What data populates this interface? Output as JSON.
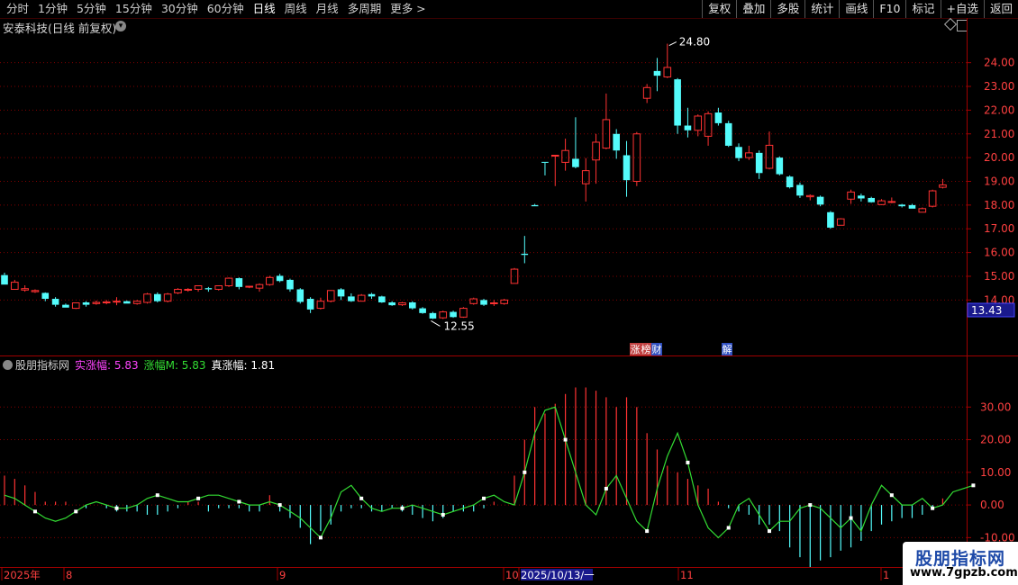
{
  "toolbar": {
    "periods": [
      "分时",
      "1分钟",
      "5分钟",
      "15分钟",
      "30分钟",
      "60分钟",
      "日线",
      "周线",
      "月线",
      "多周期",
      "更多 >"
    ],
    "active_period": "日线",
    "tools": [
      "复权",
      "叠加",
      "多股",
      "统计",
      "画线",
      "F10",
      "标记",
      "+自选",
      "返回"
    ]
  },
  "title": {
    "stock": "安泰科技(日线 前复权)"
  },
  "price_panel": {
    "max_label": "24.80",
    "min_label": "12.55",
    "current_price": "13.43",
    "ticks": [
      "24.00",
      "23.00",
      "22.00",
      "21.00",
      "20.00",
      "19.00",
      "18.00",
      "17.00",
      "16.00",
      "15.00",
      "14.00"
    ],
    "events": [
      "涨",
      "榜",
      "财",
      "解"
    ]
  },
  "indicator": {
    "name": "股朋指标网",
    "legend": [
      {
        "label": "实涨幅: 5.83",
        "color": "#ff44ff"
      },
      {
        "label": "涨幅M: 5.83",
        "color": "#33dd33"
      },
      {
        "label": "真涨幅: 1.81",
        "color": "#ffffff"
      }
    ],
    "ticks": [
      "30.00",
      "20.00",
      "10.00",
      "0.00",
      "-10.00"
    ]
  },
  "time_axis": {
    "labels": [
      "2025年",
      "8",
      "9",
      "10",
      "2025/10/13/一",
      "11",
      "1"
    ]
  },
  "watermark": {
    "line1": "股朋指标网",
    "line2": "www.7gpzb.com"
  },
  "colors": {
    "up": "#ff3232",
    "down": "#54fcfc",
    "grid": "#800000",
    "bg": "#000000"
  },
  "chart_data": {
    "type": "candlestick",
    "ylim": [
      11.7,
      25.2
    ],
    "indicator_ylim": [
      -19,
      40
    ],
    "candles": [
      [
        15.05,
        14.65,
        15.15,
        14.65
      ],
      [
        14.45,
        14.75,
        14.85,
        14.45
      ],
      [
        14.42,
        14.48,
        14.62,
        14.35
      ],
      [
        14.35,
        14.4,
        14.45,
        14.3
      ],
      [
        14.3,
        14.05,
        14.32,
        13.95
      ],
      [
        14.05,
        13.8,
        14.12,
        13.72
      ],
      [
        13.8,
        13.68,
        13.85,
        13.68
      ],
      [
        13.65,
        13.88,
        13.9,
        13.62
      ],
      [
        13.9,
        13.8,
        13.95,
        13.72
      ],
      [
        13.85,
        13.9,
        13.98,
        13.8
      ],
      [
        13.88,
        13.92,
        14.0,
        13.82
      ],
      [
        13.92,
        13.95,
        14.12,
        13.78
      ],
      [
        13.95,
        13.85,
        13.98,
        13.85
      ],
      [
        13.85,
        13.95,
        14.0,
        13.8
      ],
      [
        13.9,
        14.25,
        14.3,
        13.85
      ],
      [
        14.25,
        13.95,
        14.32,
        13.9
      ],
      [
        13.95,
        14.25,
        14.3,
        13.9
      ],
      [
        14.3,
        14.45,
        14.5,
        14.25
      ],
      [
        14.42,
        14.45,
        14.5,
        14.35
      ],
      [
        14.45,
        14.6,
        14.62,
        14.35
      ],
      [
        14.5,
        14.45,
        14.55,
        14.35
      ],
      [
        14.45,
        14.6,
        14.62,
        14.4
      ],
      [
        14.6,
        14.92,
        14.95,
        14.55
      ],
      [
        14.92,
        14.55,
        14.95,
        14.45
      ],
      [
        14.55,
        14.58,
        14.6,
        14.5
      ],
      [
        14.5,
        14.65,
        14.7,
        14.35
      ],
      [
        14.65,
        14.95,
        15.02,
        14.6
      ],
      [
        15.02,
        14.8,
        15.1,
        14.75
      ],
      [
        14.85,
        14.45,
        14.9,
        14.35
      ],
      [
        14.45,
        13.92,
        14.5,
        13.85
      ],
      [
        14.05,
        13.6,
        14.12,
        13.45
      ],
      [
        13.65,
        13.95,
        14.1,
        13.6
      ],
      [
        13.95,
        14.4,
        14.42,
        13.9
      ],
      [
        14.45,
        14.15,
        14.5,
        14.0
      ],
      [
        14.15,
        13.95,
        14.28,
        13.92
      ],
      [
        13.95,
        14.2,
        14.25,
        13.95
      ],
      [
        14.25,
        14.15,
        14.3,
        14.05
      ],
      [
        14.15,
        13.9,
        14.18,
        13.88
      ],
      [
        13.9,
        13.78,
        13.95,
        13.75
      ],
      [
        13.8,
        13.88,
        13.92,
        13.75
      ],
      [
        13.9,
        13.65,
        13.95,
        13.6
      ],
      [
        13.65,
        13.45,
        13.7,
        13.42
      ],
      [
        13.45,
        13.22,
        13.5,
        13.2
      ],
      [
        13.25,
        13.5,
        13.55,
        13.2
      ],
      [
        13.5,
        13.28,
        13.55,
        13.25
      ],
      [
        13.28,
        13.65,
        13.7,
        13.25
      ],
      [
        13.85,
        14.05,
        14.1,
        13.8
      ],
      [
        14.0,
        13.8,
        14.05,
        13.75
      ],
      [
        13.85,
        13.88,
        14.0,
        13.75
      ],
      [
        13.85,
        14.0,
        14.05,
        13.8
      ],
      [
        14.7,
        15.3,
        15.35,
        14.7
      ],
      [
        15.95,
        15.9,
        16.7,
        15.55
      ],
      [
        18.0,
        17.95,
        18.05,
        17.95
      ],
      [
        19.82,
        19.78,
        19.82,
        19.25
      ],
      [
        20.1,
        20.1,
        20.1,
        18.8
      ],
      [
        19.8,
        20.3,
        20.8,
        19.45
      ],
      [
        19.95,
        19.6,
        21.7,
        19.55
      ],
      [
        18.9,
        19.45,
        19.98,
        18.15
      ],
      [
        19.9,
        20.65,
        21.0,
        18.9
      ],
      [
        20.4,
        21.6,
        22.7,
        20.35
      ],
      [
        21.0,
        20.3,
        21.2,
        19.95
      ],
      [
        20.1,
        19.05,
        20.7,
        18.35
      ],
      [
        19.0,
        21.0,
        21.08,
        18.8
      ],
      [
        22.5,
        22.95,
        23.1,
        22.3
      ],
      [
        23.65,
        23.45,
        24.2,
        22.8
      ],
      [
        23.4,
        23.8,
        24.8,
        23.35
      ],
      [
        23.3,
        21.35,
        23.35,
        21.0
      ],
      [
        21.35,
        21.15,
        22.1,
        20.85
      ],
      [
        21.15,
        21.75,
        21.82,
        20.9
      ],
      [
        20.9,
        21.85,
        21.95,
        20.5
      ],
      [
        21.9,
        21.45,
        22.1,
        21.35
      ],
      [
        21.45,
        20.5,
        21.55,
        20.45
      ],
      [
        20.45,
        19.98,
        20.6,
        19.85
      ],
      [
        20.0,
        20.2,
        20.5,
        19.9
      ],
      [
        20.2,
        19.35,
        20.3,
        19.1
      ],
      [
        19.55,
        20.52,
        21.1,
        19.5
      ],
      [
        20.0,
        19.3,
        20.05,
        19.25
      ],
      [
        19.2,
        18.75,
        19.25,
        18.7
      ],
      [
        18.85,
        18.4,
        18.95,
        18.3
      ],
      [
        18.35,
        18.4,
        18.45,
        18.2
      ],
      [
        18.35,
        18.02,
        18.4,
        17.95
      ],
      [
        17.7,
        17.05,
        17.75,
        17.0
      ],
      [
        17.15,
        17.42,
        17.45,
        17.15
      ],
      [
        18.25,
        18.55,
        18.65,
        18.05
      ],
      [
        18.4,
        18.28,
        18.48,
        18.15
      ],
      [
        18.3,
        18.12,
        18.35,
        18.1
      ],
      [
        18.02,
        18.18,
        18.25,
        18.0
      ],
      [
        18.15,
        18.15,
        18.32,
        18.08
      ],
      [
        18.02,
        17.95,
        18.05,
        17.9
      ],
      [
        18.0,
        17.85,
        18.05,
        17.85
      ],
      [
        17.7,
        17.85,
        17.9,
        17.7
      ],
      [
        17.95,
        18.6,
        18.65,
        17.9
      ],
      [
        18.75,
        18.85,
        19.1,
        18.7
      ]
    ],
    "indicator_series": {
      "hist": [
        9,
        8,
        6,
        4,
        1,
        1,
        1,
        0,
        -1,
        0,
        -1,
        -2,
        -2,
        -2,
        -3,
        -3,
        -2,
        -1,
        1,
        1,
        -2,
        -1,
        -1,
        -1,
        -2,
        -2,
        3,
        -2,
        -4,
        -7,
        -12,
        -8,
        -6,
        -2,
        -1,
        -1,
        -2,
        -2,
        -1,
        -2,
        -3,
        -4,
        -5,
        -4,
        -2,
        -2,
        -2,
        -1,
        1,
        0,
        9,
        20,
        30,
        28,
        31,
        34,
        36,
        36,
        35,
        33,
        30,
        33,
        30,
        22,
        17,
        12,
        10,
        8,
        6,
        5,
        1,
        -1,
        -2,
        -3,
        -6,
        -6,
        -8,
        -13,
        -16,
        -19,
        -17,
        -16,
        -14,
        -13,
        -11,
        -8,
        -6,
        -5,
        -4,
        -4,
        -3,
        -1,
        2
      ],
      "line": [
        3,
        2,
        0,
        -2,
        -4,
        -5,
        -4,
        -2,
        0,
        1,
        0,
        -1,
        -1,
        0,
        2,
        3,
        2,
        1,
        1,
        2,
        3,
        3,
        2,
        1,
        0,
        0,
        1,
        0,
        -2,
        -4,
        -7,
        -10,
        -4,
        4,
        6,
        2,
        -1,
        -2,
        -1,
        -1,
        0,
        -1,
        -2,
        -3,
        -2,
        -1,
        0,
        2,
        3,
        1,
        0,
        10,
        22,
        29,
        30,
        20,
        10,
        0,
        -3,
        5,
        9,
        2,
        -5,
        -8,
        5,
        15,
        22,
        13,
        0,
        -7,
        -10,
        -7,
        0,
        2,
        -3,
        -8,
        -5,
        -5,
        -1,
        0,
        -1,
        -4,
        -7,
        -4,
        -8,
        0,
        6,
        3,
        0,
        0,
        2,
        -1,
        0,
        4,
        5,
        6
      ]
    }
  }
}
